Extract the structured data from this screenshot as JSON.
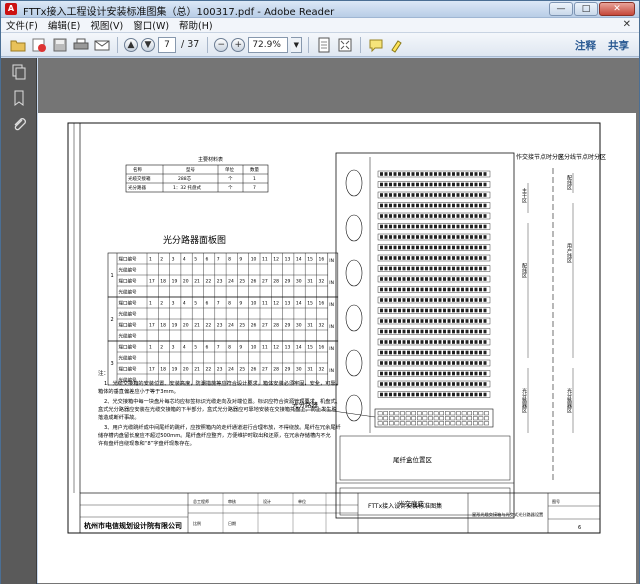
{
  "window": {
    "title": "FTTx接入工程设计安装标准图集（总）100317.pdf - Adobe Reader",
    "buttons": {
      "minimize": "—",
      "maximize": "□",
      "close": "✕"
    }
  },
  "menubar": {
    "items": [
      "文件(F)",
      "编辑(E)",
      "视图(V)",
      "窗口(W)",
      "帮助(H)"
    ],
    "close_doc": "✕"
  },
  "toolbar": {
    "current_page": "7",
    "total_pages": "/ 37",
    "zoom": "72.9%",
    "right_links": [
      "注释",
      "共享"
    ]
  },
  "drawing": {
    "materials_title": "主要材料表",
    "materials_headers": [
      "名称",
      "型号",
      "单位",
      "数量"
    ],
    "materials_rows": [
      [
        "光缆交接箱",
        "288芯",
        "个",
        "1"
      ],
      [
        "光分路器",
        "1：32 托盘式",
        "个",
        "7"
      ]
    ],
    "panel_title": "光分路器面板图",
    "row_labels": [
      "端口编号",
      "光缆编号"
    ],
    "side_labels": [
      "1",
      "2",
      "3"
    ],
    "port_numbers_top": [
      "1",
      "2",
      "3",
      "4",
      "5",
      "6",
      "7",
      "8",
      "9",
      "10",
      "11",
      "12",
      "13",
      "14",
      "15",
      "16"
    ],
    "port_numbers_bottom": [
      "17",
      "18",
      "19",
      "20",
      "21",
      "22",
      "23",
      "24",
      "25",
      "26",
      "27",
      "28",
      "29",
      "30",
      "31",
      "32"
    ],
    "in_label": "IN",
    "notes_title": "注：",
    "notes": [
      "1、光缆交接箱的安装位置、安装高度，防潮措施等应符合设计要求。箱体安装必须牢固，安全，可靠，箱体的垂直偏差应小于等于3mm。",
      "2、光交接箱中每一块盘片每芯均应标签标识光缆走向及对端位置。标识应符合资源管理要求。机盘式、盒式光分路器应安装在光缆交接箱的下半部分，盒式光分路器应可靠地安装在交接箱托盘上，防止发生脱落造成断纤事故。",
      "3、用户光缆跳纤成中间尾纤的跳纤，应按照箱内的走纤通道进行合理布放，不得绕放。尾纤在冗余尾纤储存槽内盘留长度应不超过500mm。尾纤盘纤应整齐，方便维护时取出和还原，在冗余存储槽内不允许有盘纤自绕现象和“8”字盘纤现象存在。"
    ],
    "cabinet_labels": {
      "splitter": "光分路器",
      "tail_fiber": "尾纤盒位置区",
      "base": "光交底座"
    },
    "zone_headers": [
      "作交接节点时分区",
      "光分线节点时分区"
    ],
    "zone_left": [
      "主干区",
      "配线区",
      "光分路器区"
    ],
    "zone_right": [
      "配线区",
      "用户线区",
      "光分路器区"
    ],
    "title_block": {
      "company": "杭州市电信规划设计院有限公司",
      "project": "FTTx接入设计安装标准图集",
      "drawing": "星形光缆交接箱与光交式光分路器设置",
      "cells": [
        "总工程师",
        "审核",
        "设计",
        "单位",
        "比例",
        "日期",
        "图号"
      ],
      "sheet_no": "6"
    }
  },
  "colors": {
    "title_bar": "#c9daf0",
    "doc_background": "#757575",
    "nav_pane": "#5a5a5a",
    "link": "#2a5a93"
  }
}
